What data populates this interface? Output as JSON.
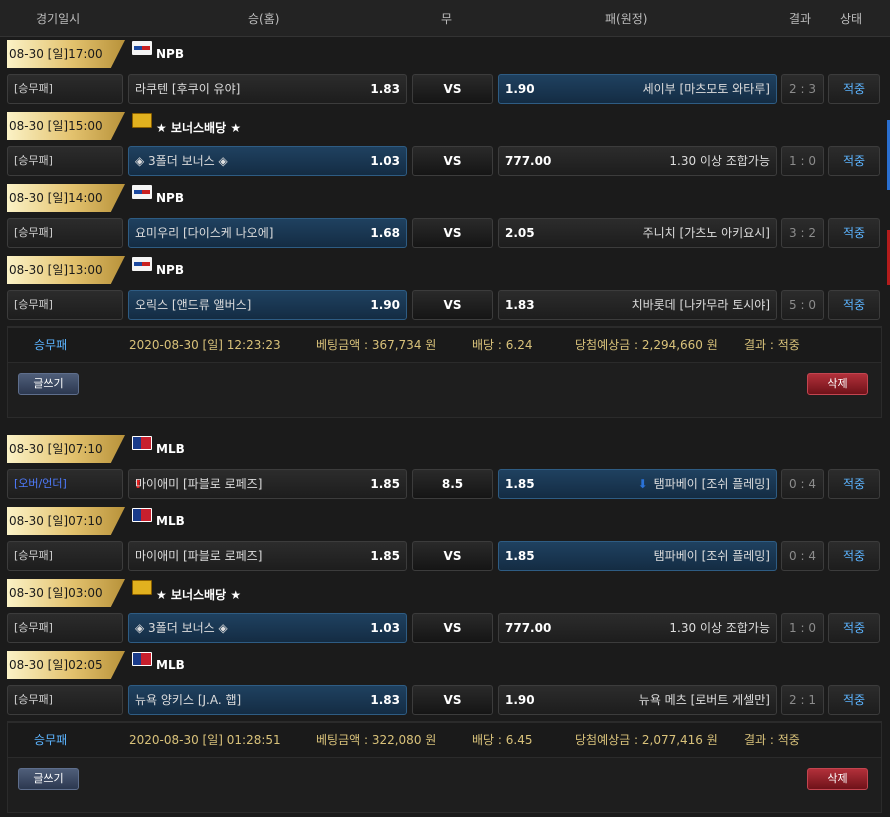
{
  "header": {
    "col_date": "경기일시",
    "col_home": "승(홈)",
    "col_draw": "무",
    "col_away": "패(원정)",
    "col_result": "결과",
    "col_status": "상태"
  },
  "slips": [
    {
      "games": [
        {
          "datetime": "08-30 [일]17:00",
          "league": "NPB",
          "league_icon": "npb-logo-icon",
          "type": "[승무패]",
          "home": "라쿠텐 [후쿠이 유야]",
          "home_odds": "1.83",
          "mid": "VS",
          "away": "세이부 [마츠모토 와타루]",
          "away_odds": "1.90",
          "score": "2 : 3",
          "status": "적중",
          "pick": "away"
        },
        {
          "datetime": "08-30 [일]15:00",
          "league": "★ 보너스배당 ★",
          "league_icon": "bonus-icon",
          "type": "[승무패]",
          "home": "◈ 3폴더 보너스 ◈",
          "home_odds": "1.03",
          "mid": "VS",
          "away": "1.30 이상 조합가능",
          "away_odds": "777.00",
          "score": "1 : 0",
          "status": "적중",
          "pick": "home"
        },
        {
          "datetime": "08-30 [일]14:00",
          "league": "NPB",
          "league_icon": "npb-logo-icon",
          "type": "[승무패]",
          "home": "요미우리 [다이스케 나오에]",
          "home_odds": "1.68",
          "mid": "VS",
          "away": "주니치 [가츠노 아키요시]",
          "away_odds": "2.05",
          "score": "3 : 2",
          "status": "적중",
          "pick": "home"
        },
        {
          "datetime": "08-30 [일]13:00",
          "league": "NPB",
          "league_icon": "npb-logo-icon",
          "type": "[승무패]",
          "home": "오릭스 [앤드류 앨버스]",
          "home_odds": "1.90",
          "mid": "VS",
          "away": "치바롯데 [나카무라 토시야]",
          "away_odds": "1.83",
          "score": "5 : 0",
          "status": "적중",
          "pick": "home"
        }
      ],
      "summary": {
        "type": "승무패",
        "time": "2020-08-30 [일] 12:23:23",
        "bet": "베팅금액 : 367,734 원",
        "odds": "배당 : 6.24",
        "expected": "당첨예상금 : 2,294,660 원",
        "result": "결과 : 적중"
      },
      "write_label": "글쓰기",
      "delete_label": "삭제"
    },
    {
      "games": [
        {
          "datetime": "08-30 [일]07:10",
          "league": "MLB",
          "league_icon": "mlb-logo-icon",
          "type": "[오버/언더]",
          "home": "마이애미 [파블로 로페즈]",
          "home_odds": "1.85",
          "mid": "8.5",
          "away": "탬파베이 [조쉬 플레밍]",
          "away_odds": "1.85",
          "score": "0 : 4",
          "status": "적중",
          "pick": "away",
          "ou": true
        },
        {
          "datetime": "08-30 [일]07:10",
          "league": "MLB",
          "league_icon": "mlb-logo-icon",
          "type": "[승무패]",
          "home": "마이애미 [파블로 로페즈]",
          "home_odds": "1.85",
          "mid": "VS",
          "away": "탬파베이 [조쉬 플레밍]",
          "away_odds": "1.85",
          "score": "0 : 4",
          "status": "적중",
          "pick": "away"
        },
        {
          "datetime": "08-30 [일]03:00",
          "league": "★ 보너스배당 ★",
          "league_icon": "bonus-icon",
          "type": "[승무패]",
          "home": "◈ 3폴더 보너스 ◈",
          "home_odds": "1.03",
          "mid": "VS",
          "away": "1.30 이상 조합가능",
          "away_odds": "777.00",
          "score": "1 : 0",
          "status": "적중",
          "pick": "home"
        },
        {
          "datetime": "08-30 [일]02:05",
          "league": "MLB",
          "league_icon": "mlb-logo-icon",
          "type": "[승무패]",
          "home": "뉴욕 양키스 [J.A. 햅]",
          "home_odds": "1.83",
          "mid": "VS",
          "away": "뉴욕 메츠 [로버트 게셀만]",
          "away_odds": "1.90",
          "score": "2 : 1",
          "status": "적중",
          "pick": "home"
        }
      ],
      "summary": {
        "type": "승무패",
        "time": "2020-08-30 [일] 01:28:51",
        "bet": "베팅금액 : 322,080 원",
        "odds": "배당 : 6.45",
        "expected": "당첨예상금 : 2,077,416 원",
        "result": "결과 : 적중"
      },
      "write_label": "글쓰기",
      "delete_label": "삭제"
    }
  ],
  "colors": {
    "accent_blue": "#5cb4ff",
    "selected_bg": "#1f4160",
    "delete_red": "#b2303a",
    "gold": "#d9c27a"
  }
}
